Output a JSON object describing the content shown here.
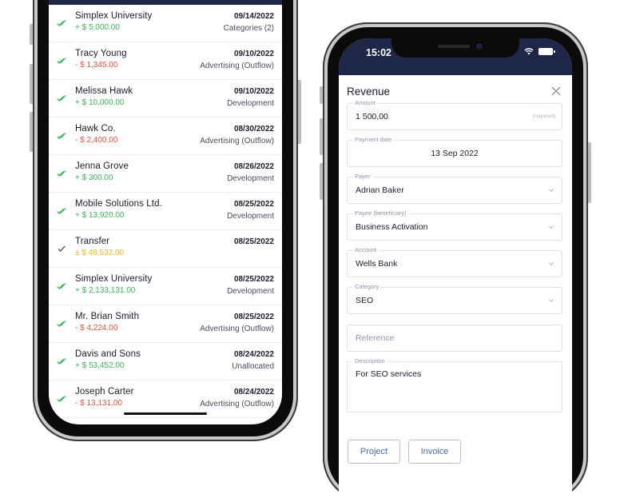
{
  "left_phone": {
    "transactions": [
      {
        "name": "Simplex University",
        "amount": "+ $ 5,000.00",
        "amount_color": "#3bb55a",
        "date": "09/14/2022",
        "category": "Categories (2)",
        "status_color": "#3bb55a"
      },
      {
        "name": "Tracy Young",
        "amount": "- $ 1,345.00",
        "amount_color": "#e0533e",
        "date": "09/10/2022",
        "category": "Advertising (Outflow)",
        "status_color": "#3bb55a"
      },
      {
        "name": "Melissa Hawk",
        "amount": "+ $ 10,000.00",
        "amount_color": "#3bb55a",
        "date": "09/10/2022",
        "category": "Development",
        "status_color": "#3bb55a"
      },
      {
        "name": "Hawk Co.",
        "amount": "- $ 2,400.00",
        "amount_color": "#e0533e",
        "date": "08/30/2022",
        "category": "Advertising (Outflow)",
        "status_color": "#3bb55a"
      },
      {
        "name": "Jenna Grove",
        "amount": "+ $ 300.00",
        "amount_color": "#3bb55a",
        "date": "08/26/2022",
        "category": "Development",
        "status_color": "#3bb55a"
      },
      {
        "name": "Mobile Solutions Ltd.",
        "amount": "+ $ 13,920.00",
        "amount_color": "#3bb55a",
        "date": "08/25/2022",
        "category": "Development",
        "status_color": "#3bb55a"
      },
      {
        "name": "Transfer",
        "amount": "± $ 48,532.00",
        "amount_color": "#e9b825",
        "date": "08/25/2022",
        "category": "",
        "status_color": "#555a66"
      },
      {
        "name": "Simplex University",
        "amount": "+ $ 2,133,131.00",
        "amount_color": "#3bb55a",
        "date": "08/25/2022",
        "category": "Development",
        "status_color": "#3bb55a"
      },
      {
        "name": "Mr. Brian Smith",
        "amount": "- $ 4,224.00",
        "amount_color": "#e0533e",
        "date": "08/25/2022",
        "category": "Advertising (Outflow)",
        "status_color": "#3bb55a"
      },
      {
        "name": "Davis and Sons",
        "amount": "+ $ 53,452.00",
        "amount_color": "#3bb55a",
        "date": "08/24/2022",
        "category": "Unallocated",
        "status_color": "#3bb55a"
      },
      {
        "name": "Joseph Carter",
        "amount": "- $ 13,131.00",
        "amount_color": "#e0533e",
        "date": "08/24/2022",
        "category": "Advertising (Outflow)",
        "status_color": "#3bb55a"
      }
    ]
  },
  "right_phone": {
    "status_time": "15:02",
    "form": {
      "title": "Revenue",
      "amount": {
        "label": "Amount",
        "value": "1 500,00",
        "hint": "(required)"
      },
      "payment_date": {
        "label": "Payment date",
        "value": "13 Sep 2022"
      },
      "payer": {
        "label": "Payer",
        "value": "Adrian Baker"
      },
      "payee": {
        "label": "Payee (beneficiary)",
        "value": "Business Activation"
      },
      "account": {
        "label": "Account",
        "value": "Wells Bank"
      },
      "category": {
        "label": "Category",
        "value": "SEO"
      },
      "reference": {
        "placeholder": "Reference"
      },
      "description": {
        "label": "Description",
        "value": "For SEO services"
      },
      "project_button": "Project",
      "invoice_button": "Invoice"
    }
  },
  "colors": {
    "navy": "#1f2748",
    "positive": "#3bb55a",
    "negative": "#e0533e",
    "transfer": "#e9b825",
    "button_text": "#4a6ab0"
  }
}
